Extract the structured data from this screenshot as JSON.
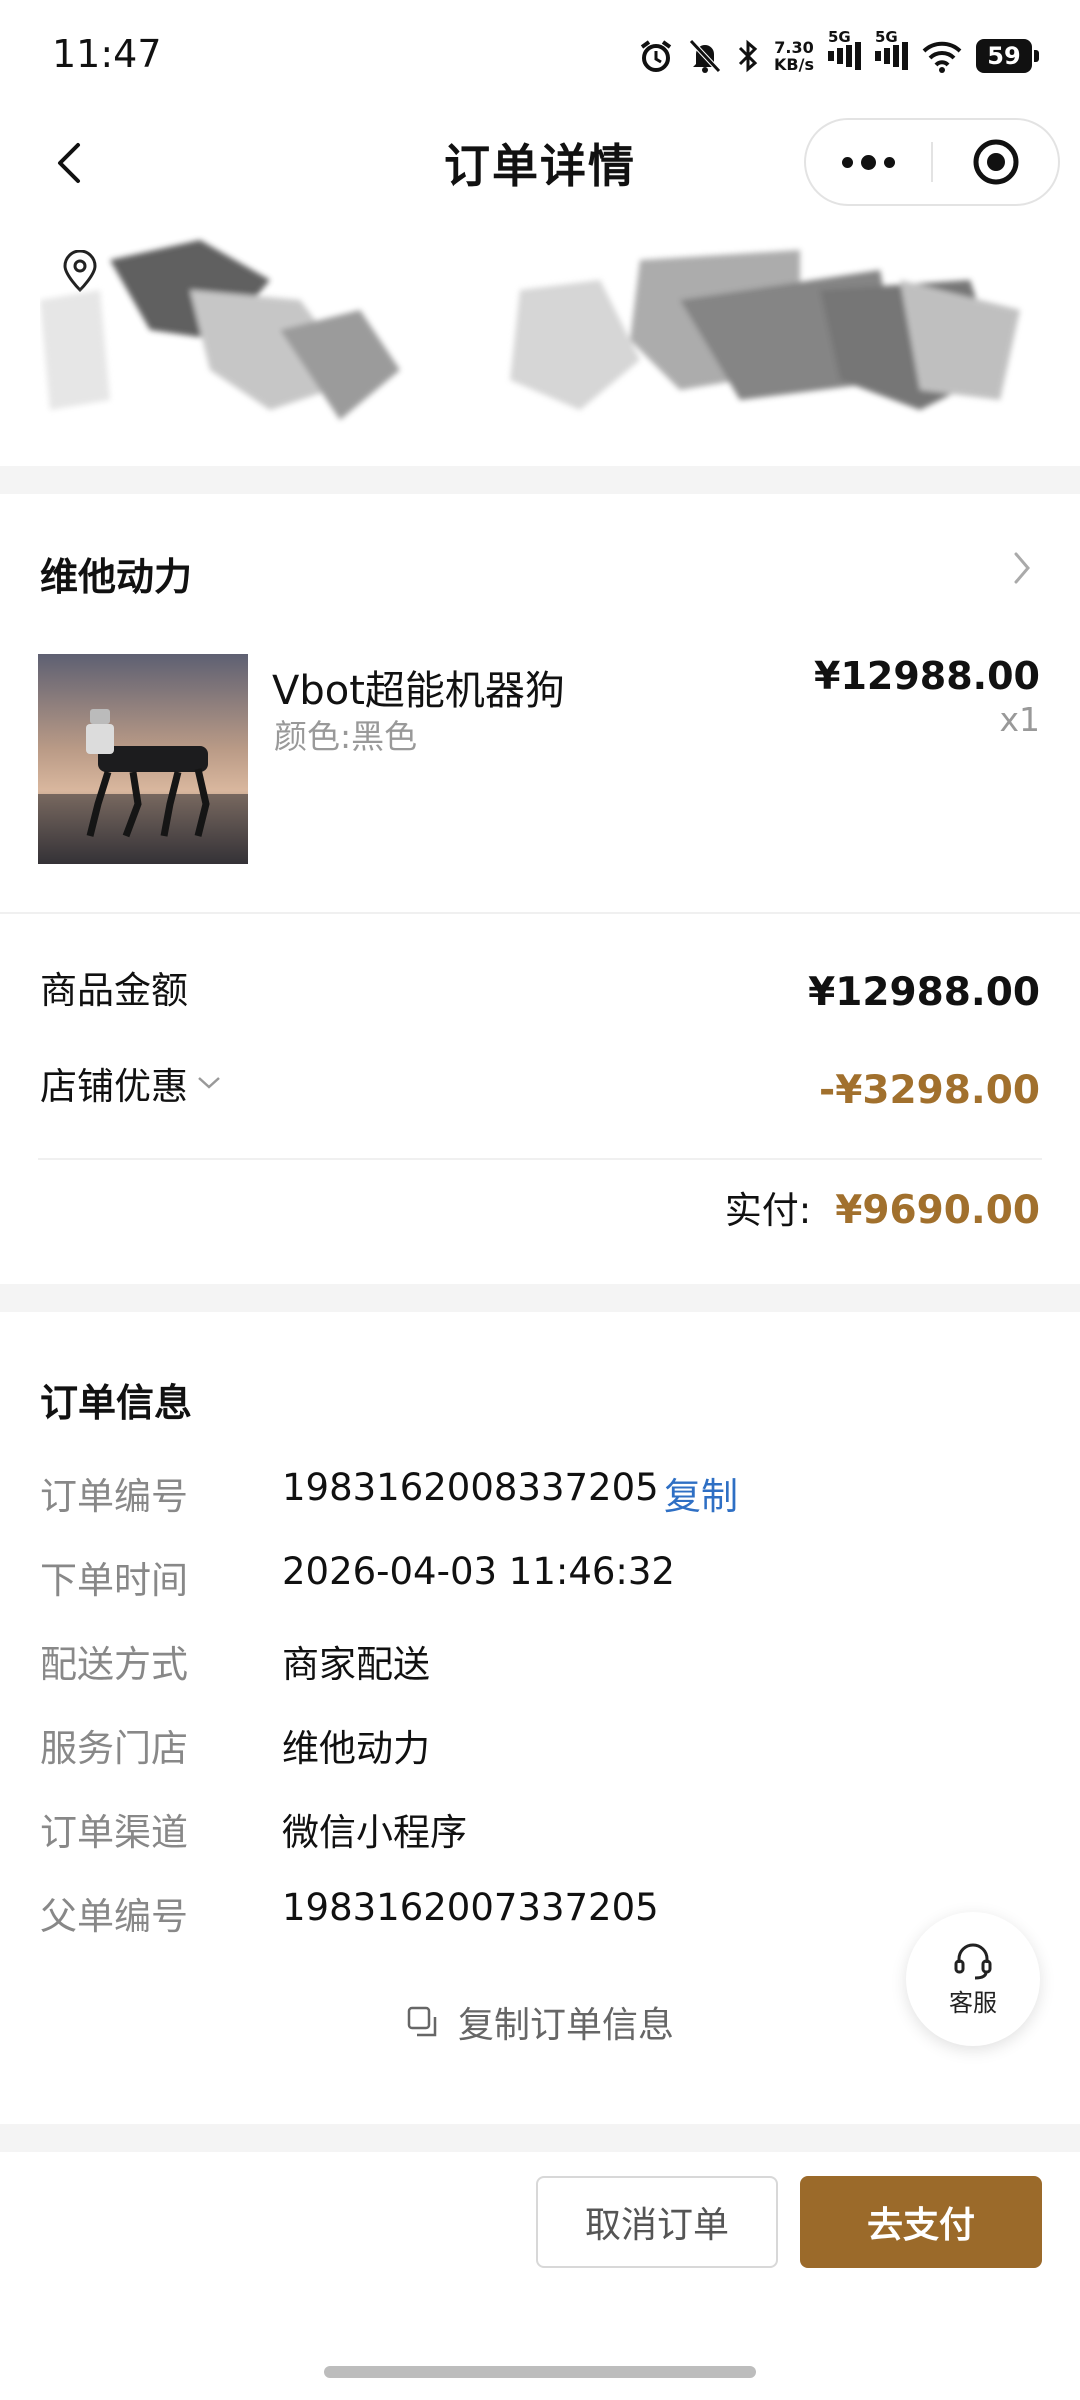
{
  "status_bar": {
    "time": "11:47",
    "net_speed_value": "7.30",
    "net_speed_unit": "KB/s",
    "sig1_label": "5G",
    "sig2_label": "5G",
    "battery": "59",
    "icons": [
      "alarm-icon",
      "mute-bell-icon",
      "bluetooth-icon",
      "signal-icon",
      "signal-icon",
      "wifi-icon",
      "battery-icon"
    ]
  },
  "nav": {
    "title": "订单详情",
    "icons": [
      "back-chevron-icon",
      "more-dots-icon",
      "target-icon"
    ]
  },
  "shop": {
    "name": "维他动力",
    "product": {
      "title": "Vbot超能机器狗",
      "spec": "颜色:黑色",
      "price": "¥12988.00",
      "qty": "x1"
    }
  },
  "summary": {
    "goods_label": "商品金额",
    "goods_amount": "¥12988.00",
    "discount_label": "店铺优惠",
    "discount_amount": "-¥3298.00",
    "paid_label": "实付:",
    "paid_amount": "¥9690.00"
  },
  "order_info": {
    "title": "订单信息",
    "copy_link": "复制",
    "rows": [
      {
        "label": "订单编号",
        "value": "1983162008337205"
      },
      {
        "label": "下单时间",
        "value": "2026-04-03 11:46:32"
      },
      {
        "label": "配送方式",
        "value": "商家配送"
      },
      {
        "label": "服务门店",
        "value": "维他动力"
      },
      {
        "label": "订单渠道",
        "value": "微信小程序"
      },
      {
        "label": "父单编号",
        "value": "1983162007337205"
      }
    ],
    "copy_all": "复制订单信息"
  },
  "customer_service": {
    "label": "客服"
  },
  "actions": {
    "cancel": "取消订单",
    "pay": "去支付"
  },
  "colors": {
    "accent_gold": "#a1702d",
    "pay_button": "#9b6a2a",
    "link_blue": "#2e6fc4"
  }
}
